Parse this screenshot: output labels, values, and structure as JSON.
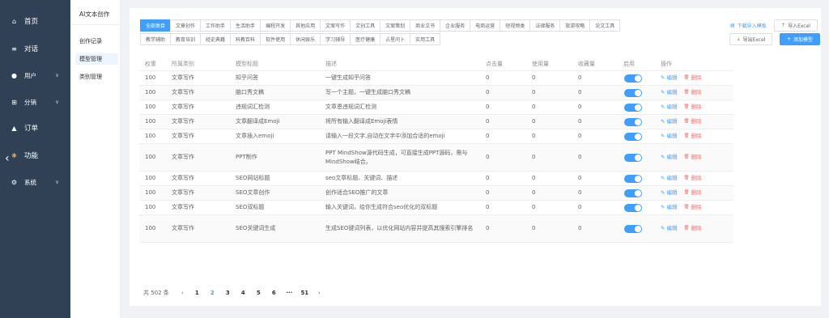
{
  "sidebar": {
    "items": [
      {
        "label": "首页",
        "icon": "home-icon",
        "glyph": "⌂"
      },
      {
        "label": "对话",
        "icon": "list-icon",
        "glyph": "≡"
      },
      {
        "label": "用户",
        "icon": "user-icon",
        "glyph": "●"
      },
      {
        "label": "分销",
        "icon": "share-icon",
        "glyph": "⊞"
      },
      {
        "label": "订单",
        "icon": "order-icon",
        "glyph": "▲"
      },
      {
        "label": "功能",
        "icon": "function-icon",
        "glyph": "✱"
      },
      {
        "label": "系统",
        "icon": "gear-icon",
        "glyph": "⚙"
      }
    ],
    "collapse_glyph": "‹"
  },
  "submenu": {
    "title": "AI文本创作",
    "items": [
      "创作记录",
      "模型管理",
      "类别管理"
    ],
    "active_index": 1
  },
  "tabs_row1": [
    "全部类目",
    "文章创作",
    "工作助手",
    "生活助手",
    "编程开发",
    "其他应用",
    "文案写作",
    "文创工具",
    "文案策划",
    "商业文书",
    "企业服务",
    "电商运营",
    "短视频类",
    "法律服务",
    "旅游攻略",
    "论文工具"
  ],
  "tabs_row2": [
    "教学辅助",
    "教育培训",
    "经史典籍",
    "科教百科",
    "软件使用",
    "休闲娱乐",
    "学习辅导",
    "医疗健康",
    "占星问卜",
    "实用工具"
  ],
  "actions": {
    "download_template": "下载导入模板",
    "import_excel": "导入Excel",
    "export_excel": "导出Excel",
    "add_model": "添加模型"
  },
  "table": {
    "headers": [
      "权重",
      "所属类别",
      "模型标题",
      "描述",
      "点击量",
      "使用量",
      "收藏量",
      "启用",
      "操作"
    ],
    "edit_label": "编辑",
    "delete_label": "删除",
    "rows": [
      {
        "weight": "100",
        "category": "文章写作",
        "title": "知乎问答",
        "desc": "一键生成知乎问答",
        "clicks": "0",
        "uses": "0",
        "favs": "0"
      },
      {
        "weight": "100",
        "category": "文章写作",
        "title": "脑口秀文稿",
        "desc": "写一个主题，一键生成脑口秀文稿",
        "clicks": "0",
        "uses": "0",
        "favs": "0"
      },
      {
        "weight": "100",
        "category": "文章写作",
        "title": "违规词汇检测",
        "desc": "文章恩违规词汇检测",
        "clicks": "0",
        "uses": "0",
        "favs": "0"
      },
      {
        "weight": "100",
        "category": "文章写作",
        "title": "文章翻译成Emoji",
        "desc": "将所有输入翻译成Emoji表情",
        "clicks": "0",
        "uses": "0",
        "favs": "0"
      },
      {
        "weight": "100",
        "category": "文章写作",
        "title": "文章插入emoji",
        "desc": "请输入一段文字,自动在文字中添加合适的emoji",
        "clicks": "0",
        "uses": "0",
        "favs": "0"
      },
      {
        "weight": "100",
        "category": "文章写作",
        "title": "PPT制作",
        "desc": "PPT MindShow源代码生成，可直接生成PPT源码，需与MindShow结合。",
        "clicks": "0",
        "uses": "0",
        "favs": "0"
      },
      {
        "weight": "100",
        "category": "文章写作",
        "title": "SEO网站标题",
        "desc": "seo文章标题、关键词、描述",
        "clicks": "0",
        "uses": "0",
        "favs": "0"
      },
      {
        "weight": "100",
        "category": "文章写作",
        "title": "SEO文章创作",
        "desc": "创作适合SEO推广的文章",
        "clicks": "0",
        "uses": "0",
        "favs": "0"
      },
      {
        "weight": "100",
        "category": "文章写作",
        "title": "SEO双标题",
        "desc": "输入关键词，给你生成符合seo优化的双标题",
        "clicks": "0",
        "uses": "0",
        "favs": "0"
      },
      {
        "weight": "100",
        "category": "文章写作",
        "title": "SEO关键词生成",
        "desc": "生成SEO键词列表，以优化网站内容并提高其搜索引擎排名",
        "clicks": "0",
        "uses": "0",
        "favs": "0"
      }
    ]
  },
  "pagination": {
    "total": "共 502 条",
    "prev": "‹",
    "next": "›",
    "pages": [
      "1",
      "2",
      "3",
      "4",
      "5",
      "6",
      "···",
      "51"
    ],
    "active_index": 1
  },
  "colors": {
    "sidebar_bg": "#304156",
    "primary": "#409eff",
    "danger": "#f56c6c"
  }
}
